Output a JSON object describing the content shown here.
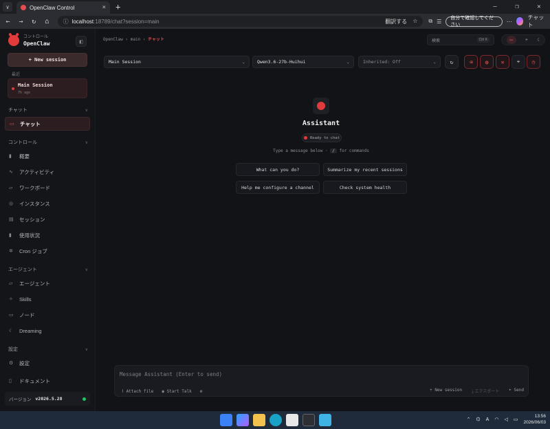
{
  "browser": {
    "tab_title": "OpenClaw Control",
    "url_host": "localhost",
    "url_rest": ":18789/chat?session=main",
    "translate_label": "翻訳する",
    "profile_label": "自分で確認してください",
    "copilot_label": "チャット",
    "new_tab": "+",
    "tab_menu": "∨",
    "tab_close": "×",
    "win_min": "—",
    "win_max": "❐",
    "win_close": "✕"
  },
  "sidebar": {
    "brand_sub": "コントロール",
    "brand_name": "OpenClaw",
    "new_session": "+  New session",
    "recent_label": "最近",
    "recent_session": {
      "title": "Main Session",
      "time": "7h ago"
    },
    "groups": [
      {
        "label": "チャット",
        "items": [
          {
            "label": "チャット",
            "icon": "chat-icon"
          }
        ]
      },
      {
        "label": "コントロール",
        "items": [
          {
            "label": "概要",
            "icon": "bar-chart-icon"
          },
          {
            "label": "アクティビティ",
            "icon": "activity-icon"
          },
          {
            "label": "ワークボード",
            "icon": "folder-icon"
          },
          {
            "label": "インスタンス",
            "icon": "broadcast-icon"
          },
          {
            "label": "セッション",
            "icon": "document-icon"
          },
          {
            "label": "使用状況",
            "icon": "bar-chart-icon"
          },
          {
            "label": "Cron ジョブ",
            "icon": "loader-icon"
          }
        ]
      },
      {
        "label": "エージェント",
        "items": [
          {
            "label": "エージェント",
            "icon": "folder-icon"
          },
          {
            "label": "Skills",
            "icon": "sparkle-icon"
          },
          {
            "label": "ノード",
            "icon": "monitor-icon"
          },
          {
            "label": "Dreaming",
            "icon": "moon-icon"
          }
        ]
      },
      {
        "label": "設定",
        "items": [
          {
            "label": "設定",
            "icon": "gear-icon"
          }
        ]
      }
    ],
    "docs": "ドキュメント",
    "version_label": "バージョン",
    "version_value": "v2026.5.28"
  },
  "main": {
    "breadcrumb": [
      "OpenClaw",
      "main",
      "チャット"
    ],
    "search_placeholder": "検索",
    "search_kbd": "Ctrl K",
    "session_select": "Main Session",
    "model_select": "Qwen3.6-27b-Huihui",
    "inherit_select": "Inherited: Off",
    "assistant_name": "Assistant",
    "status": "Ready to chat",
    "hint_before": "Type a message below · ",
    "hint_key": "/",
    "hint_after": " for commands",
    "suggestions": [
      "What can you do?",
      "Summarize my recent sessions",
      "Help me configure a channel",
      "Check system health"
    ],
    "composer_placeholder": "Message Assistant (Enter to send)",
    "attach": "Attach file",
    "talk": "Start Talk",
    "new_session": "New session",
    "export": "エクスポート",
    "send": "Send"
  },
  "taskbar": {
    "time": "13:56",
    "date": "2026/06/03"
  }
}
